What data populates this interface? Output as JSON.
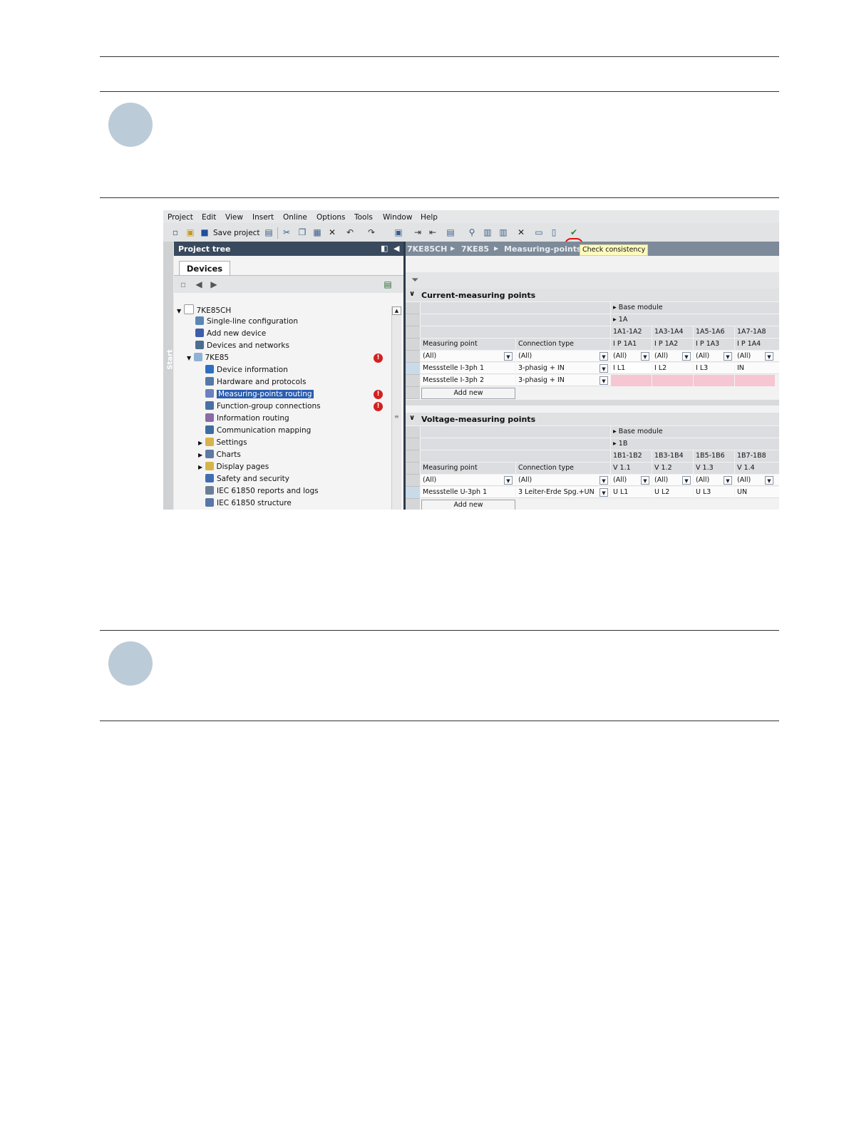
{
  "menu": [
    "Project",
    "Edit",
    "View",
    "Insert",
    "Online",
    "Options",
    "Tools",
    "Window",
    "Help"
  ],
  "toolbar": {
    "save_label": "Save project",
    "tooltip": "Check consistency"
  },
  "tree": {
    "title": "Project tree",
    "tab": "Devices",
    "side_label": "Start",
    "items": [
      {
        "label": "7KE85CH"
      },
      {
        "label": "Single-line configuration"
      },
      {
        "label": "Add new device"
      },
      {
        "label": "Devices and networks"
      },
      {
        "label": "7KE85"
      },
      {
        "label": "Device information"
      },
      {
        "label": "Hardware and protocols"
      },
      {
        "label": "Measuring-points routing"
      },
      {
        "label": "Function-group connections"
      },
      {
        "label": "Information routing"
      },
      {
        "label": "Communication mapping"
      },
      {
        "label": "Settings"
      },
      {
        "label": "Charts"
      },
      {
        "label": "Display pages"
      },
      {
        "label": "Safety and security"
      },
      {
        "label": "IEC 61850 reports and logs"
      },
      {
        "label": "IEC 61850 structure"
      }
    ]
  },
  "breadcrumb": [
    "7KE85CH",
    "7KE85",
    "Measuring-points r"
  ],
  "current": {
    "title": "Current-measuring points",
    "module": "Base module",
    "slot": "1A",
    "terminals": [
      "1A1-1A2",
      "1A3-1A4",
      "1A5-1A6",
      "1A7-1A8"
    ],
    "col_mp": "Measuring point",
    "col_ct": "Connection type",
    "channels": [
      "I P 1A1",
      "I P 1A2",
      "I P 1A3",
      "I P 1A4"
    ],
    "filter": "(All)",
    "rows": [
      {
        "mp": "Messstelle I-3ph 1",
        "ct": "3-phasig + IN",
        "v": [
          "I L1",
          "I L2",
          "I L3",
          "IN"
        ]
      },
      {
        "mp": "Messstelle I-3ph 2",
        "ct": "3-phasig + IN",
        "v": [
          "",
          "",
          "",
          ""
        ]
      }
    ],
    "add_new": "Add new"
  },
  "voltage": {
    "title": "Voltage-measuring points",
    "module": "Base module",
    "slot": "1B",
    "terminals": [
      "1B1-1B2",
      "1B3-1B4",
      "1B5-1B6",
      "1B7-1B8"
    ],
    "col_mp": "Measuring point",
    "col_ct": "Connection type",
    "channels": [
      "V 1.1",
      "V 1.2",
      "V 1.3",
      "V 1.4"
    ],
    "filter": "(All)",
    "rows": [
      {
        "mp": "Messstelle U-3ph 1",
        "ct": "3 Leiter-Erde Spg.+UN",
        "v": [
          "U L1",
          "U L2",
          "U L3",
          "UN"
        ]
      }
    ],
    "add_new": "Add new"
  },
  "error_glyph": "!"
}
